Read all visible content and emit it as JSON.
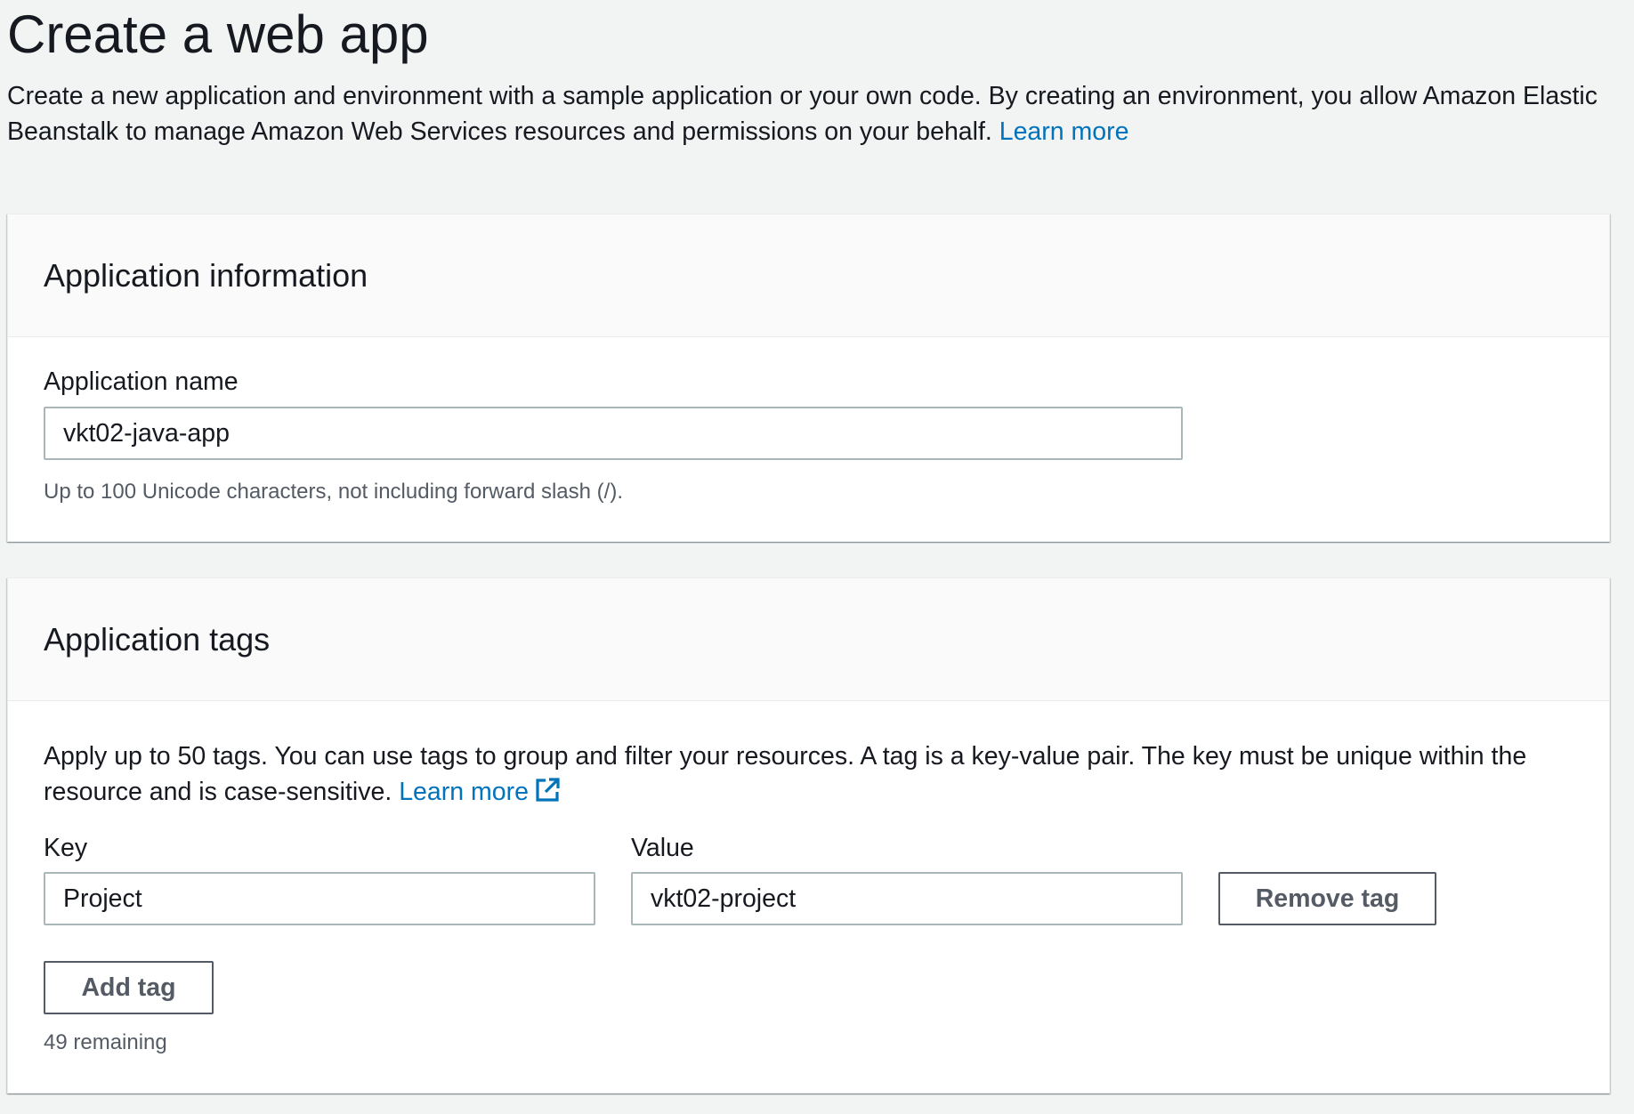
{
  "page": {
    "title": "Create a web app",
    "description": "Create a new application and environment with a sample application or your own code. By creating an environment, you allow Amazon Elastic Beanstalk to manage Amazon Web Services resources and permissions on your behalf.",
    "learn_more": "Learn more"
  },
  "app_info": {
    "title": "Application information",
    "name_label": "Application name",
    "name_value": "vkt02-java-app",
    "name_hint": "Up to 100 Unicode characters, not including forward slash (/)."
  },
  "app_tags": {
    "title": "Application tags",
    "description": "Apply up to 50 tags. You can use tags to group and filter your resources. A tag is a key-value pair. The key must be unique within the resource and is case-sensitive.",
    "learn_more": "Learn more",
    "key_label": "Key",
    "value_label": "Value",
    "tags": [
      {
        "key": "Project",
        "value": "vkt02-project"
      }
    ],
    "remove_label": "Remove tag",
    "add_label": "Add tag",
    "remaining": "49 remaining",
    "external_icon": "external-link-icon"
  },
  "colors": {
    "link": "#0073bb",
    "text": "#16191f",
    "muted": "#545b64",
    "background": "#f2f3f3",
    "border": "#aab7b8"
  }
}
